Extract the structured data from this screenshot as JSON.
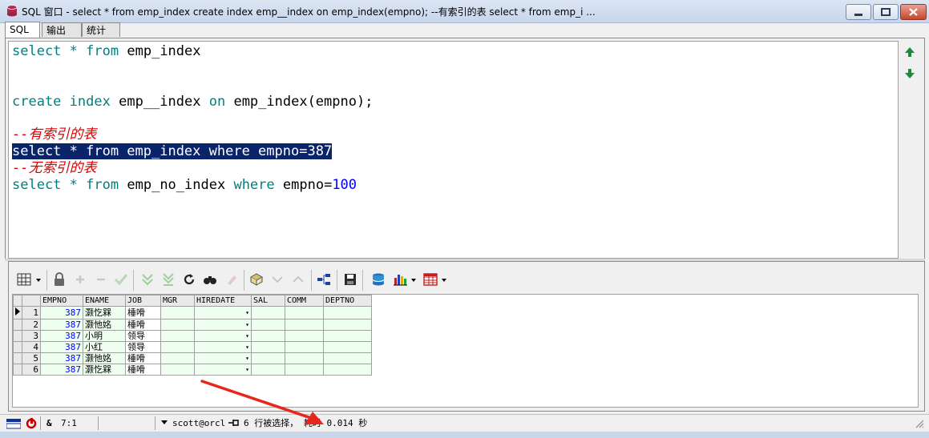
{
  "window": {
    "title": "SQL 窗口 - select * from emp_index create index emp__index on emp_index(empno); --有索引的表 select * from emp_i ..."
  },
  "tabs": [
    "SQL",
    "输出",
    "统计"
  ],
  "editor": {
    "line1": [
      "select",
      "*",
      "from",
      "emp_index"
    ],
    "line2": [
      "create",
      "index",
      "emp__index",
      "on",
      "emp_index(empno);"
    ],
    "comment1": "--有索引的表",
    "selected_line": "select * from emp_index where empno=387",
    "comment2": "--无索引的表",
    "line5": [
      "select",
      "*",
      "from",
      "emp_no_index",
      "where",
      "empno=",
      "100"
    ]
  },
  "grid": {
    "columns": [
      "EMPNO",
      "ENAME",
      "JOB",
      "MGR",
      "HIREDATE",
      "SAL",
      "COMM",
      "DEPTNO"
    ],
    "rows": [
      {
        "n": "1",
        "empno": "387",
        "ename": "灏忔槑",
        "job": "棰嗗"
      },
      {
        "n": "2",
        "empno": "387",
        "ename": "灏忚姳",
        "job": "棰嗗"
      },
      {
        "n": "3",
        "empno": "387",
        "ename": "小明",
        "job": "领导"
      },
      {
        "n": "4",
        "empno": "387",
        "ename": "小红",
        "job": "领导"
      },
      {
        "n": "5",
        "empno": "387",
        "ename": "灏忚姳",
        "job": "棰嗗"
      },
      {
        "n": "6",
        "empno": "387",
        "ename": "灏忔槑",
        "job": "棰嗗"
      }
    ],
    "dropdown_glyph": "▾"
  },
  "status": {
    "ampersand": "&",
    "position": "7:1",
    "connection": "scott@orcl",
    "message": "6 行被选择， 耗时 0.014 秒"
  },
  "colors": {
    "keyword": "#008080",
    "comment": "#e00000",
    "number": "#0000ff",
    "selection": "#0a246a",
    "annotation_arrow": "#e8271c"
  }
}
